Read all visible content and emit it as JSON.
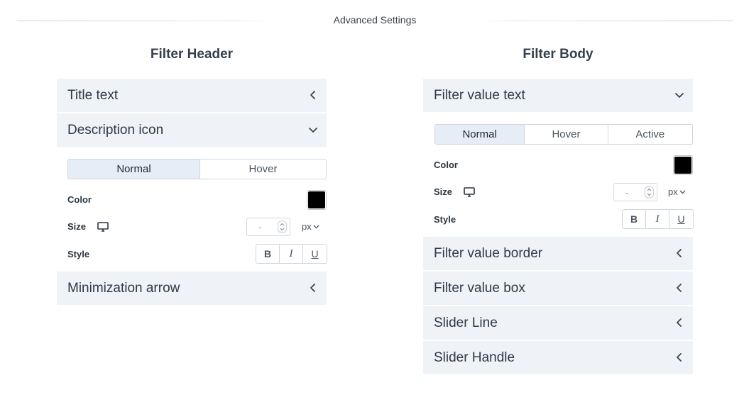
{
  "advanced": {
    "title": "Advanced Settings"
  },
  "left": {
    "title": "Filter Header",
    "sections": [
      {
        "label": "Title text",
        "state": "collapsed",
        "chevron": "chevron-left-icon"
      },
      {
        "label": "Description icon",
        "state": "expanded",
        "chevron": "chevron-down-icon"
      },
      {
        "label": "Minimization arrow",
        "state": "collapsed",
        "chevron": "chevron-left-icon"
      }
    ],
    "tabs": [
      "Normal",
      "Hover"
    ],
    "active_tab": "Normal",
    "color_label": "Color",
    "color_value": "#000000",
    "size_label": "Size",
    "size_value": "-",
    "size_unit": "px",
    "style_label": "Style",
    "style_buttons": [
      "B",
      "I",
      "U"
    ]
  },
  "right": {
    "title": "Filter Body",
    "sections": [
      {
        "label": "Filter value text",
        "state": "expanded",
        "chevron": "chevron-down-icon"
      },
      {
        "label": "Filter value border",
        "state": "collapsed",
        "chevron": "chevron-left-icon"
      },
      {
        "label": "Filter value box",
        "state": "collapsed",
        "chevron": "chevron-left-icon"
      },
      {
        "label": "Slider Line",
        "state": "collapsed",
        "chevron": "chevron-left-icon"
      },
      {
        "label": "Slider Handle",
        "state": "collapsed",
        "chevron": "chevron-left-icon"
      }
    ],
    "tabs": [
      "Normal",
      "Hover",
      "Active"
    ],
    "active_tab": "Normal",
    "color_label": "Color",
    "color_value": "#000000",
    "size_label": "Size",
    "size_value": "-",
    "size_unit": "px",
    "style_label": "Style",
    "style_buttons": [
      "B",
      "I",
      "U"
    ]
  }
}
